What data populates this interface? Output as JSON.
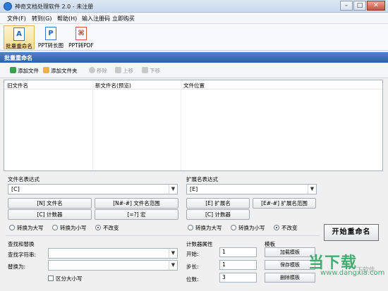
{
  "window": {
    "title": "神奇文档处理软件 2.0 - 未注册",
    "controls": [
      "–",
      "□",
      "✕"
    ]
  },
  "menu": [
    "文件(F)",
    "转到(G)",
    "帮助(H)",
    "输入注册码",
    "立即购买"
  ],
  "toolbar": {
    "buttons": [
      {
        "label": "批量重命名",
        "icon": "rename-doc-icon",
        "glyph": "A"
      },
      {
        "label": "PPT转长图",
        "icon": "ppt-doc-icon",
        "glyph": "P"
      },
      {
        "label": "PPT转PDF",
        "icon": "pdf-doc-icon",
        "glyph": "⌘"
      }
    ]
  },
  "section_title": "批量重命名",
  "actions": {
    "add_file": "添加文件",
    "add_folder": "添加文件夹",
    "remove": "移除",
    "move_up": "上移",
    "move_down": "下移"
  },
  "file_list": {
    "columns": [
      "旧文件名",
      "新文件名(预览)",
      "文件位置"
    ],
    "rows": []
  },
  "filename_expr": {
    "label": "文件名表达式",
    "value": "[C]",
    "buttons": [
      "[N] 文件名",
      "[N#-#] 文件名范围",
      "[C] 计数器",
      "[=?] 宏"
    ],
    "case_options": [
      "转换为大写",
      "转换为小写",
      "不改变"
    ],
    "case_selected": 2
  },
  "ext_expr": {
    "label": "扩展名表达式",
    "value": "[E]",
    "buttons": [
      "[E] 扩展名",
      "[E#-#] 扩展名范围",
      "[C] 计数器"
    ],
    "case_options": [
      "转换为大写",
      "转换为小写",
      "不改变"
    ],
    "case_selected": 2
  },
  "start_button": "开始重命名",
  "find_replace": {
    "title": "查找和替换",
    "find_label": "查找字符串:",
    "replace_label": "替换为:",
    "case_sensitive": "区分大小写"
  },
  "counter": {
    "title": "计数器属性",
    "start_label": "开始:",
    "start_value": "1",
    "step_label": "步长:",
    "step_value": "1",
    "digits_label": "位数:",
    "digits_value": "3"
  },
  "template": {
    "title": "模板",
    "buttons": [
      "加载模板",
      "保存模板",
      "删除模板"
    ]
  },
  "watermark": {
    "main": "当下载",
    "sub": "www.dangxia.com",
    "side": "下软件"
  }
}
